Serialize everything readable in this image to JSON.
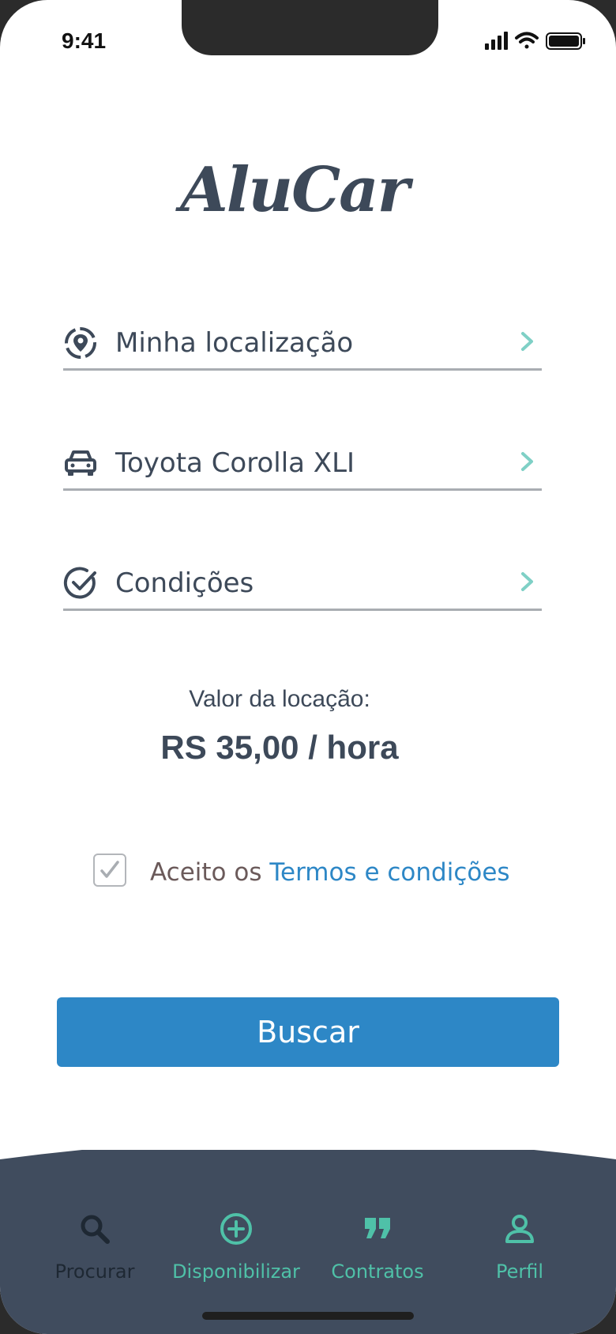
{
  "status_bar": {
    "time": "9:41"
  },
  "logo": {
    "text": "AluCar"
  },
  "fields": [
    {
      "label": "Minha localização",
      "icon": "location-pin-icon"
    },
    {
      "label": "Toyota Corolla XLI",
      "icon": "car-icon"
    },
    {
      "label": "Condições",
      "icon": "check-circle-icon"
    }
  ],
  "price": {
    "label": "Valor da locação:",
    "value": "RS 35,00 / hora"
  },
  "terms": {
    "checked": true,
    "prefix": "Aceito os ",
    "link": "Termos e condições"
  },
  "search_button": {
    "label": "Buscar"
  },
  "bottom_nav": {
    "items": [
      {
        "label": "Procurar",
        "icon": "search-icon",
        "active": true
      },
      {
        "label": "Disponibilizar",
        "icon": "add-circle-icon",
        "active": false
      },
      {
        "label": "Contratos",
        "icon": "quote-icon",
        "active": false
      },
      {
        "label": "Perfil",
        "icon": "user-icon",
        "active": false
      }
    ]
  },
  "colors": {
    "primary": "#2d87c6",
    "text_dark": "#3d4959",
    "nav_bg": "#404c5e",
    "nav_active": "#1e2833",
    "nav_inactive": "#4fc1a8",
    "chevron": "#7fd0c6"
  }
}
